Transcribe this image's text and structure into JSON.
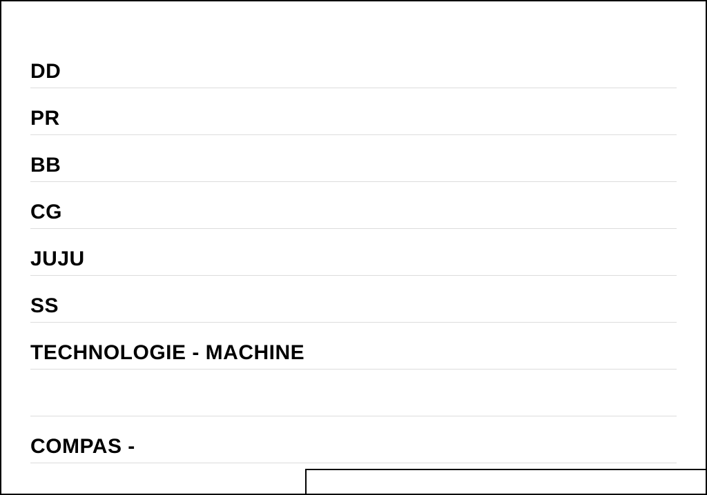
{
  "rows": [
    {
      "label": "DD"
    },
    {
      "label": "PR"
    },
    {
      "label": "BB"
    },
    {
      "label": "CG"
    },
    {
      "label": "JUJU"
    },
    {
      "label": "SS"
    },
    {
      "label": "TECHNOLOGIE - MACHINE"
    },
    {
      "label": ""
    },
    {
      "label": "COMPAS -"
    }
  ]
}
